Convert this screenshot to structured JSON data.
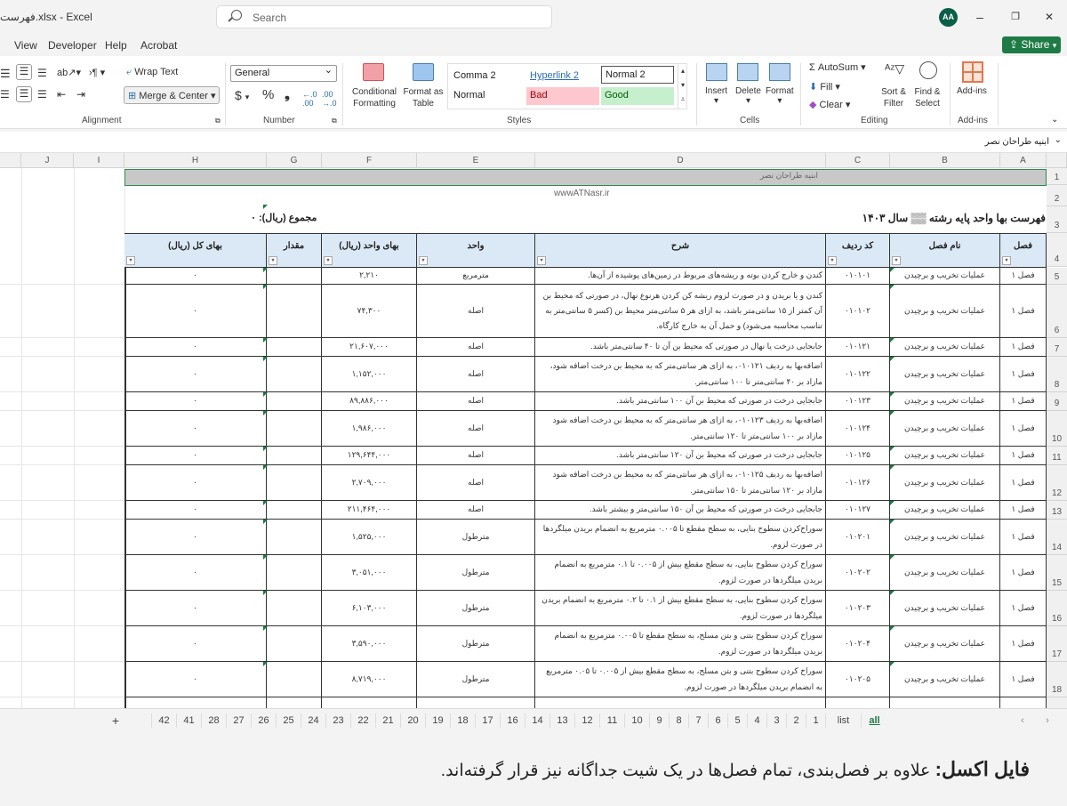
{
  "window": {
    "title": "فهرست.xlsx - Excel",
    "search_placeholder": "Search",
    "avatar": "AA",
    "minimize": "–",
    "restore": "❐",
    "close": "✕"
  },
  "menu": {
    "items": [
      "View",
      "Developer",
      "Help",
      "Acrobat"
    ],
    "share": "Share"
  },
  "ribbon": {
    "alignment": {
      "label": "Alignment",
      "wrap_text": "Wrap Text",
      "merge_center": "Merge & Center"
    },
    "number": {
      "label": "Number",
      "format": "General",
      "currency": "$",
      "percent": "%",
      "comma": "❟"
    },
    "styles": {
      "label": "Styles",
      "conditional": "Conditional Formatting",
      "format_table": "Format as Table",
      "gallery": [
        "Comma 2",
        "Hyperlink 2",
        "Normal 2",
        "Normal",
        "Bad",
        "Good"
      ]
    },
    "cells": {
      "label": "Cells",
      "insert": "Insert",
      "delete": "Delete",
      "format": "Format"
    },
    "editing": {
      "label": "Editing",
      "autosum": "AutoSum",
      "fill": "Fill",
      "clear": "Clear",
      "sort_filter": "Sort & Filter",
      "find_select": "Find & Select"
    },
    "addins": {
      "label": "Add-ins",
      "addins": "Add-ins"
    }
  },
  "formula_bar": {
    "name_box": "ابنیه طراحان نصر"
  },
  "colors": {
    "accent": "#1e7b45",
    "header_fill": "#dbe9f7",
    "bad": "#ffc7ce",
    "good": "#c6efce",
    "merged_fill": "#c8c8c8"
  },
  "sheet": {
    "columns": [
      "A",
      "B",
      "C",
      "D",
      "E",
      "F",
      "G",
      "H",
      "I",
      "J"
    ],
    "banner": "ابنیه طراحان نصر",
    "website": "wwwATNasr.ir",
    "title": "فهرست بها واحد پایه رشته ▒▒ سال ۱۴۰۳",
    "total": "مجموع (ریال): ۰",
    "headers": [
      "فصل",
      "نام فصل",
      "کد ردیف",
      "شرح",
      "واحد",
      "بهای واحد (ریال)",
      "مقدار",
      "بهای کل (ریال)"
    ],
    "rows": [
      {
        "n": "5",
        "fasl": "فصل ۱",
        "name": "عملیات تخریب و برچیدن",
        "code": "۰۱۰۱۰۱",
        "desc": "کندن و خارج کردن بوته و ریشه‌های مربوط در زمین‌های پوشیده از آن‌ها.",
        "unit": "مترمربع",
        "price": "۲,۲۱۰",
        "qty": "",
        "total": "۰"
      },
      {
        "n": "6",
        "fasl": "فصل ۱",
        "name": "عملیات تخریب و برچیدن",
        "code": "۰۱۰۱۰۲",
        "desc": "کندن و یا بریدن و در صورت لزوم ریشه کن کردن هرنوع نهال، در صورتی که محیط بن آن کمتر از ۱۵ سانتی‌متر باشد، به ازای هر ۵ سانتی‌متر محیط بن (کسر ۵ سانتی‌متر به تناسب محاسبه می‌شود) و حمل آن به خارج کارگاه.",
        "unit": "اصله",
        "price": "۷۴,۳۰۰",
        "qty": "",
        "total": "۰"
      },
      {
        "n": "7",
        "fasl": "فصل ۱",
        "name": "عملیات تخریب و برچیدن",
        "code": "۰۱۰۱۲۱",
        "desc": "جابجایی درخت یا نهال در صورتی که محیط بن آن تا ۴۰ سانتی‌متر باشد.",
        "unit": "اصله",
        "price": "۲۱,۶۰۷,۰۰۰",
        "qty": "",
        "total": "۰"
      },
      {
        "n": "8",
        "fasl": "فصل ۱",
        "name": "عملیات تخریب و برچیدن",
        "code": "۰۱۰۱۲۲",
        "desc": "اضافه‌بها به ردیف ۰۱۰۱۲۱، به ازای هر سانتی‌متر که به محیط بن درخت اضافه شود، مازاد بر ۴۰ سانتی‌متر تا ۱۰۰ سانتی‌متر.",
        "unit": "اصله",
        "price": "۱,۱۵۲,۰۰۰",
        "qty": "",
        "total": "۰"
      },
      {
        "n": "9",
        "fasl": "فصل ۱",
        "name": "عملیات تخریب و برچیدن",
        "code": "۰۱۰۱۲۳",
        "desc": "جابجایی درخت در صورتی که محیط بن آن ۱۰۰ سانتی‌متر باشد.",
        "unit": "اصله",
        "price": "۸۹,۸۸۶,۰۰۰",
        "qty": "",
        "total": "۰"
      },
      {
        "n": "10",
        "fasl": "فصل ۱",
        "name": "عملیات تخریب و برچیدن",
        "code": "۰۱۰۱۲۴",
        "desc": "اضافه‌بها به ردیف ۰۱۰۱۲۳، به ازای هر سانتی‌متر که به محیط بن درخت اضافه شود مازاد بر ۱۰۰ سانتی‌متر تا ۱۲۰ سانتی‌متر.",
        "unit": "اصله",
        "price": "۱,۹۸۶,۰۰۰",
        "qty": "",
        "total": "۰"
      },
      {
        "n": "11",
        "fasl": "فصل ۱",
        "name": "عملیات تخریب و برچیدن",
        "code": "۰۱۰۱۲۵",
        "desc": "جابجایی درخت در صورتی که محیط بن آن ۱۲۰ سانتی‌متر باشد.",
        "unit": "اصله",
        "price": "۱۲۹,۶۴۴,۰۰۰",
        "qty": "",
        "total": "۰"
      },
      {
        "n": "12",
        "fasl": "فصل ۱",
        "name": "عملیات تخریب و برچیدن",
        "code": "۰۱۰۱۲۶",
        "desc": "اضافه‌بها به ردیف ۰۱۰۱۲۵، به ازای هر سانتی‌متر که به محیط بن درخت اضافه شود مازاد بر ۱۲۰ سانتی‌متر تا ۱۵۰ سانتی‌متر.",
        "unit": "اصله",
        "price": "۲,۷۰۹,۰۰۰",
        "qty": "",
        "total": "۰"
      },
      {
        "n": "13",
        "fasl": "فصل ۱",
        "name": "عملیات تخریب و برچیدن",
        "code": "۰۱۰۱۲۷",
        "desc": "جابجایی درخت در صورتی که محیط بن آن ۱۵۰ سانتی‌متر و بیشتر باشد.",
        "unit": "اصله",
        "price": "۲۱۱,۴۶۴,۰۰۰",
        "qty": "",
        "total": "۰"
      },
      {
        "n": "14",
        "fasl": "فصل ۱",
        "name": "عملیات تخریب و برچیدن",
        "code": "۰۱۰۲۰۱",
        "desc": "سوراخ‌کردن سطوح بنایی، به سطح مقطع تا ۰.۰۰۵ مترمربع به انضمام بریدن میلگردها در صورت لزوم.",
        "unit": "مترطول",
        "price": "۱,۵۲۵,۰۰۰",
        "qty": "",
        "total": "۰"
      },
      {
        "n": "15",
        "fasl": "فصل ۱",
        "name": "عملیات تخریب و برچیدن",
        "code": "۰۱۰۲۰۲",
        "desc": "سوراخ کردن سطوح بنایی، به سطح مقطع بیش از ۰.۰۰۵ تا ۰.۱ مترمربع به انضمام بریدن میلگردها در صورت لزوم.",
        "unit": "مترطول",
        "price": "۳,۰۵۱,۰۰۰",
        "qty": "",
        "total": "۰"
      },
      {
        "n": "16",
        "fasl": "فصل ۱",
        "name": "عملیات تخریب و برچیدن",
        "code": "۰۱۰۲۰۳",
        "desc": "سوراخ کردن سطوح بنایی، به سطح مقطع بیش از ۰.۱ تا ۰.۲ مترمربع به انضمام بریدن میلگردها در صورت لزوم.",
        "unit": "مترطول",
        "price": "۶,۱۰۳,۰۰۰",
        "qty": "",
        "total": "۰"
      },
      {
        "n": "17",
        "fasl": "فصل ۱",
        "name": "عملیات تخریب و برچیدن",
        "code": "۰۱۰۲۰۴",
        "desc": "سوراخ کردن سطوح بتنی و بتن مسلح، به سطح مقطع تا ۰.۰۰۵ مترمربع به انضمام بریدن میلگردها در صورت لزوم.",
        "unit": "مترطول",
        "price": "۳,۵۹۰,۰۰۰",
        "qty": "",
        "total": "۰"
      },
      {
        "n": "18",
        "fasl": "فصل ۱",
        "name": "عملیات تخریب و برچیدن",
        "code": "۰۱۰۲۰۵",
        "desc": "سوراخ کردن سطوح بتنی و بتن مسلح، به سطح مقطع بیش از ۰.۰۰۵ تا ۰.۰۵ مترمربع به انضمام بریدن میلگردها در صورت لزوم.",
        "unit": "مترطول",
        "price": "۸,۷۱۹,۰۰۰",
        "qty": "",
        "total": "۰"
      }
    ]
  },
  "tabs": {
    "add": "+",
    "items": [
      "42",
      "41",
      "28",
      "27",
      "26",
      "25",
      "24",
      "23",
      "22",
      "21",
      "20",
      "19",
      "18",
      "17",
      "16",
      "14",
      "13",
      "12",
      "11",
      "10",
      "9",
      "8",
      "7",
      "6",
      "5",
      "4",
      "3",
      "2",
      "1",
      "list",
      "all"
    ],
    "active": "all",
    "prev": "‹",
    "next": "›"
  },
  "caption": {
    "bold": "فایل اکسل:",
    "text": " علاوه بر فصل‌بندی، تمام فصل‌ها در یک شیت جداگانه نیز قرار گرفته‌اند."
  }
}
